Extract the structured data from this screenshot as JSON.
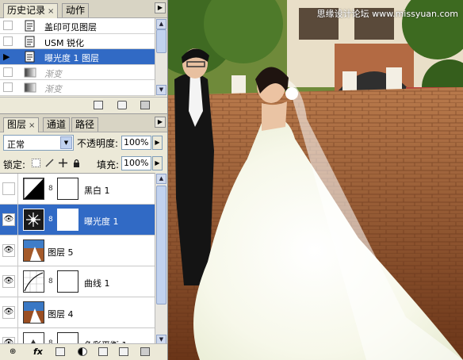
{
  "watermark": "思缘设计论坛 www.missyuan.com",
  "history_panel": {
    "tabs": [
      {
        "label": "历史记录",
        "close": "×"
      },
      {
        "label": "动作"
      }
    ],
    "items": [
      {
        "label": "盖印可见图层",
        "state": "normal"
      },
      {
        "label": "USM 锐化",
        "state": "normal"
      },
      {
        "label": "曝光度 1 图层",
        "state": "selected",
        "marker": "▶"
      },
      {
        "label": "渐变",
        "state": "dimmed"
      },
      {
        "label": "渐变",
        "state": "dimmed"
      }
    ]
  },
  "layers_panel": {
    "tabs": [
      {
        "label": "图层",
        "close": "×"
      },
      {
        "label": "通道"
      },
      {
        "label": "路径"
      }
    ],
    "blend_mode": "正常",
    "opacity_label": "不透明度:",
    "opacity_value": "100%",
    "lock_label": "锁定:",
    "fill_label": "填充:",
    "fill_value": "100%",
    "layers": [
      {
        "name": "黑白 1",
        "visible": false,
        "thumb": "bw-adjust",
        "mask": true,
        "selected": false
      },
      {
        "name": "曝光度 1",
        "visible": true,
        "thumb": "exposure-adjust",
        "mask": true,
        "selected": true
      },
      {
        "name": "图层 5",
        "visible": true,
        "thumb": "photo",
        "mask": false,
        "selected": false
      },
      {
        "name": "曲线 1",
        "visible": true,
        "thumb": "curves-adjust",
        "mask": true,
        "selected": false
      },
      {
        "name": "图层 4",
        "visible": true,
        "thumb": "photo",
        "mask": false,
        "selected": false
      },
      {
        "name": "色彩平衡 1",
        "visible": true,
        "thumb": "color-balance-adjust",
        "mask": true,
        "selected": false
      }
    ],
    "footer_fx": "fx"
  },
  "colors": {
    "selection": "#316ac5",
    "panel_bg": "#ece9d8"
  }
}
